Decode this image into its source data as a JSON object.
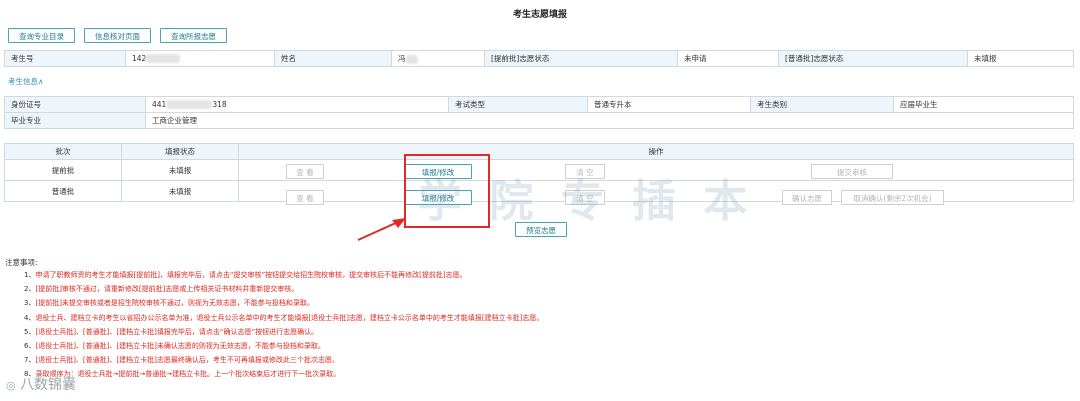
{
  "page": {
    "title": "考生志愿填报"
  },
  "toolbar": {
    "major_catalog": "查询专业目录",
    "info_check": "信息核对页面",
    "submitted": "查询所报志愿"
  },
  "row1": {
    "exam_no_label": "考生号",
    "exam_no_value": "142",
    "name_label": "姓名",
    "name_value": "冯",
    "early_status_label": "[提前批]志愿状态",
    "early_status_value": "未申请",
    "normal_status_label": "[普通批]志愿状态",
    "normal_status_value": "未填报"
  },
  "info_link": "考生信息∧",
  "info": {
    "id_label": "身份证号",
    "id_value_prefix": "441",
    "id_value_suffix": "318",
    "exam_type_label": "考试类型",
    "exam_type_value": "普通专升本",
    "category_label": "考生类别",
    "category_value": "应届毕业生",
    "major_label": "毕业专业",
    "major_value": "工商企业管理"
  },
  "batch_table": {
    "headers": {
      "batch": "批次",
      "status": "填报状态",
      "ops": "操作"
    },
    "rows": [
      {
        "batch": "提前批",
        "status": "未填报",
        "view": "查 看",
        "fill": "填报/修改",
        "clear": "清 空",
        "submit": "提交审核"
      },
      {
        "batch": "普通批",
        "status": "未填报",
        "view": "查 看",
        "fill": "填报/修改",
        "clear": "清 空",
        "confirm": "确认志愿",
        "cancel": "取消确认(剩余2次机会)"
      }
    ]
  },
  "preview": "预览志愿",
  "watermark": "学 院 专 插 本",
  "notes": {
    "title": "注意事项:",
    "items": [
      {
        "n": "1、",
        "t": "申请了职教师资的考生才能填报[提前批]，填报完毕后，请点击“提交审核”按钮提交给招生院校审核，提交审核后不能再修改[提前批]志愿。"
      },
      {
        "n": "2、",
        "t": "[提前批]审核不通过，请重新修改[提前批]志愿或上传相关证书材料并重新提交审核。"
      },
      {
        "n": "3、",
        "t": "[提前批]未提交审核或者是招生院校审核不通过，则视为无效志愿，不能参与投档和录取。"
      },
      {
        "n": "4、",
        "t": "退役士兵、建档立卡的考生以省招办公示名单为准，退役士兵公示名单中的考生才能填报[退役士兵批]志愿，建档立卡公示名单中的考生才能填报[建档立卡批]志愿。"
      },
      {
        "n": "5、",
        "t": "[退役士兵批]、[普通批]、[建档立卡批]填报完毕后，请点击“确认志愿”按钮进行志愿确认。"
      },
      {
        "n": "6、",
        "t": "[退役士兵批]、[普通批]、[建档立卡批]未确认志愿的则视为无效志愿，不能参与投档和录取。"
      },
      {
        "n": "7、",
        "t": "[退役士兵批]、[普通批]、[建档立卡批]志愿最终确认后，考生不可再填报或修改此三个批次志愿。"
      },
      {
        "n": "8、",
        "t": "录取顺序为：退役士兵批→提前批→普通批→建档立卡批。上一个批次结束后才进行下一批次录取。"
      }
    ]
  },
  "logo": "八数锦囊"
}
